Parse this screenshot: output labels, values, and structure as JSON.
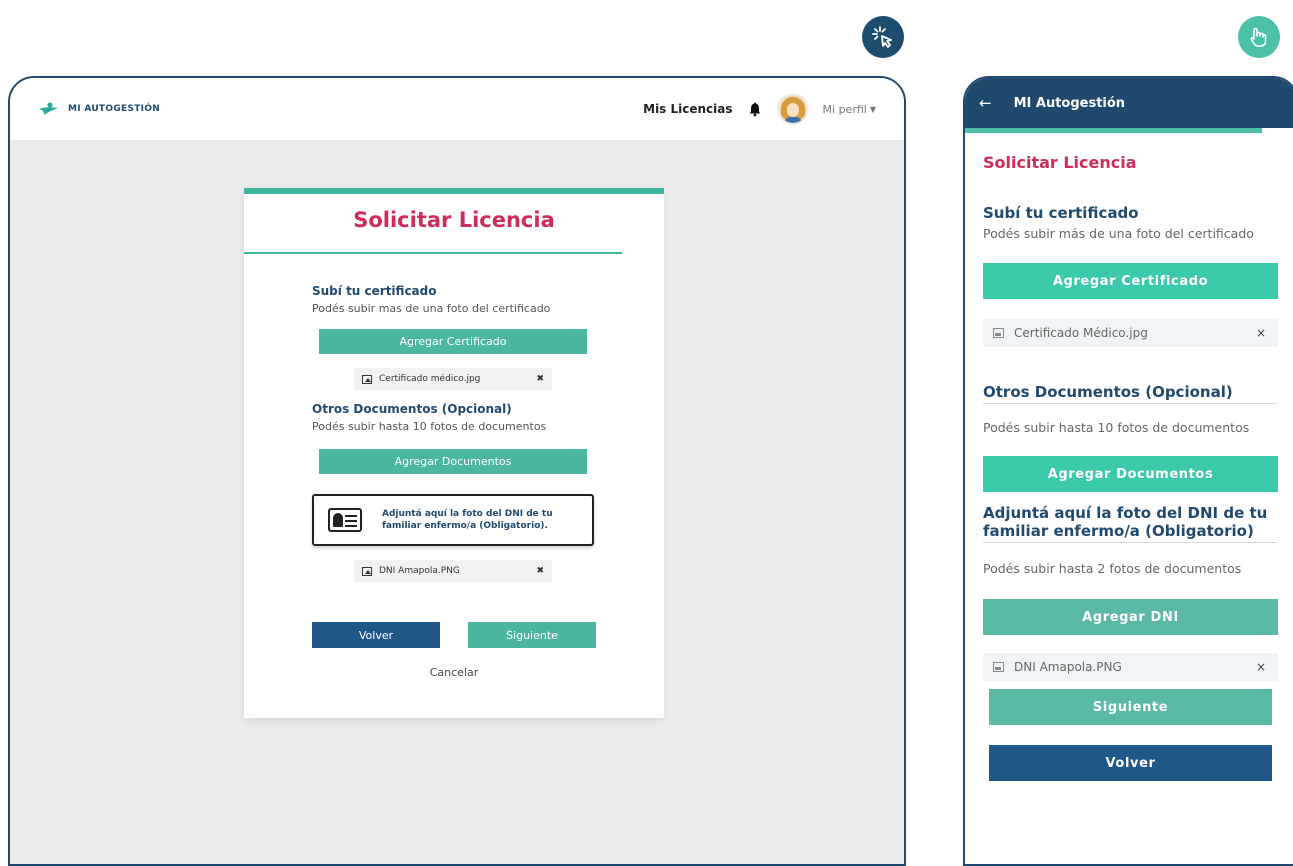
{
  "badges": {
    "desktop": "click-cursor-icon",
    "mobile": "touch-hand-icon"
  },
  "desktop": {
    "brand": "MI AUTOGESTIÓN",
    "nav": {
      "mis_licencias": "Mis Licencias",
      "perfil": "Mi perfil"
    },
    "card": {
      "title": "Solicitar Licencia",
      "cert_heading": "Subí tu certificado",
      "cert_desc": "Podés subir mas de una foto del certificado",
      "cert_button": "Agregar Certificado",
      "cert_file": "Certificado médico.jpg",
      "docs_heading": "Otros Documentos (Opcional)",
      "docs_desc": "Podés subir hasta 10 fotos de documentos",
      "docs_button": "Agregar Documentos",
      "dni_notice": "Adjuntá aquí la foto del DNI de tu familiar enfermo/a (Obligatorio).",
      "dni_file": "DNI Amapola.PNG",
      "volver": "Volver",
      "siguiente": "Siguiente",
      "cancelar": "Cancelar",
      "remove": "✖"
    }
  },
  "mobile": {
    "back": "←",
    "bar_title": "MI Autogestión",
    "title": "Solicitar Licencia",
    "cert_heading": "Subí tu certificado",
    "cert_desc": "Podés subir más de una foto del certificado",
    "cert_button": "Agregar Certificado",
    "cert_file": "Certificado Médico.jpg",
    "docs_heading": "Otros Documentos (Opcional)",
    "docs_desc": "Podés subir hasta 10 fotos de documentos",
    "docs_button": "Agregar Documentos",
    "dni_heading": "Adjuntá aquí la foto del DNI de tu familiar enfermo/a (Obligatorio)",
    "dni_desc": "Podés subir hasta 2 fotos de documentos",
    "dni_button": "Agregar DNI",
    "dni_file": "DNI Amapola.PNG",
    "siguiente": "Siguiente",
    "volver": "Volver",
    "remove": "×"
  },
  "colors": {
    "navy": "#1f4a6e",
    "teal": "#4bb6a0",
    "pink": "#cf2c5b"
  }
}
